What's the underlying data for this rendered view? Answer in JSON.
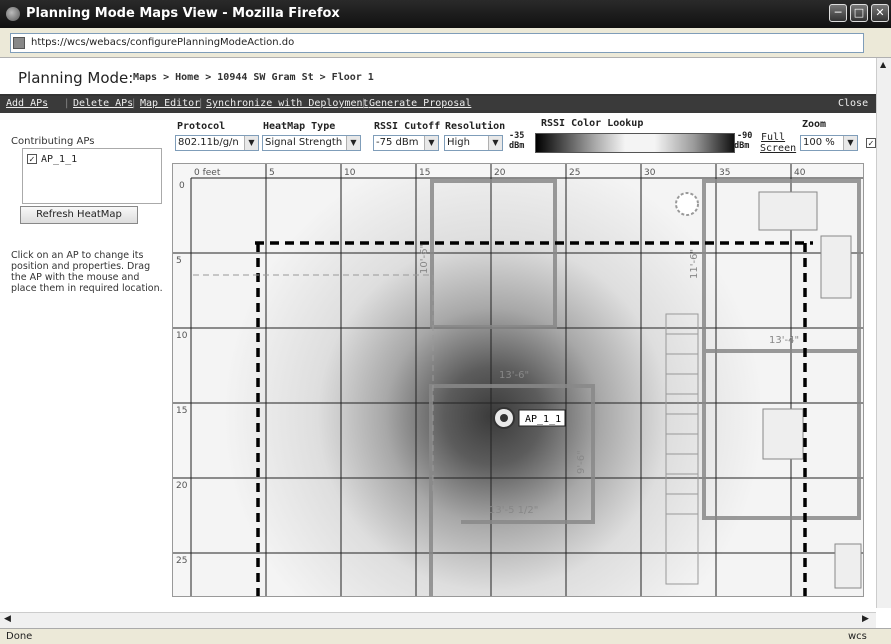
{
  "window": {
    "title": "Planning Mode Maps View - Mozilla Firefox"
  },
  "address": {
    "url": "https://wcs/webacs/configurePlanningModeAction.do"
  },
  "header": {
    "title": "Planning Mode:",
    "breadcrumb": "Maps > Home > 10944 SW Gram St > Floor 1"
  },
  "toolbar": {
    "add_aps": "Add APs",
    "delete_aps": "Delete APs",
    "map_editor": "Map Editor",
    "synchronize": "Synchronize with Deployment",
    "generate": "Generate Proposal",
    "close": "Close"
  },
  "left": {
    "contributing_label": "Contributing APs",
    "ap_name": "AP_1_1",
    "refresh_button": "Refresh HeatMap",
    "help_text": "Click on an AP to change its position and properties. Drag the AP with the mouse and place them in required location."
  },
  "controls": {
    "protocol_label": "Protocol",
    "protocol_value": "802.11b/g/n",
    "heatmap_label": "HeatMap Type",
    "heatmap_value": "Signal Strength",
    "rssi_label": "RSSI Cutoff",
    "rssi_value": "-75 dBm",
    "resolution_label": "Resolution",
    "resolution_value": "High",
    "color_lookup_label": "RSSI Color Lookup",
    "scale_min": "-35",
    "scale_min_unit": "dBm",
    "scale_max": "-90",
    "scale_max_unit": "dBm",
    "full_screen_1": "Full",
    "full_screen_2": "Screen",
    "zoom_label": "Zoom",
    "zoom_value": "100 %"
  },
  "map": {
    "x_ticks": [
      "0 feet",
      "5",
      "10",
      "15",
      "20",
      "25",
      "30",
      "35",
      "40"
    ],
    "y_ticks": [
      "0",
      "5",
      "10",
      "15",
      "20",
      "25"
    ],
    "ap_label": "AP_1_1",
    "dims": [
      "13'-6\"",
      "13'-5 1/2\"",
      "9'-6\"",
      "13'-4\"",
      "11'-6\"",
      "10'-6\""
    ]
  },
  "status": {
    "text": "Done",
    "right": "wcs"
  }
}
